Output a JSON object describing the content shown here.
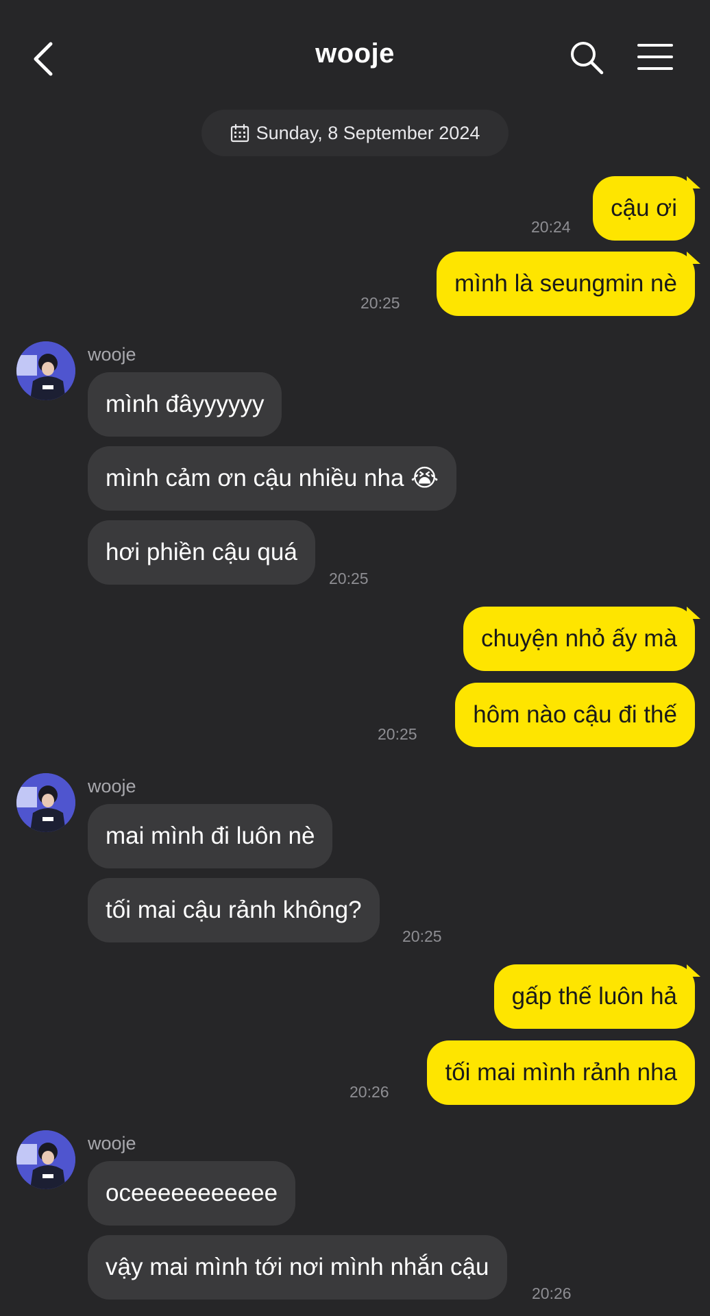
{
  "header": {
    "title": "wooje",
    "back_icon": "chevron-left-icon",
    "search_icon": "search-icon",
    "menu_icon": "hamburger-menu-icon"
  },
  "date_divider": {
    "icon": "calendar-icon",
    "text": "Sunday, 8 September 2024"
  },
  "colors": {
    "background": "#262628",
    "my_bubble": "#fee500",
    "their_bubble": "#3a3a3c",
    "timestamp": "#8e8e93"
  },
  "messages": [
    {
      "from": "me",
      "text": "cậu ơi",
      "time": "20:24"
    },
    {
      "from": "me",
      "text": "mình là seungmin nè",
      "time": "20:25"
    },
    {
      "from": "them",
      "sender": "wooje",
      "text": "mình đâyyyyyy"
    },
    {
      "from": "them",
      "text": "mình cảm ơn cậu nhiều nha 😭"
    },
    {
      "from": "them",
      "text": "hơi phiền cậu quá",
      "time": "20:25"
    },
    {
      "from": "me",
      "text": "chuyện nhỏ ấy mà"
    },
    {
      "from": "me",
      "text": "hôm nào cậu đi thế",
      "time": "20:25"
    },
    {
      "from": "them",
      "sender": "wooje",
      "text": "mai mình đi luôn nè"
    },
    {
      "from": "them",
      "text": "tối mai cậu rảnh không?",
      "time": "20:25"
    },
    {
      "from": "me",
      "text": "gấp thế luôn hả"
    },
    {
      "from": "me",
      "text": "tối mai mình rảnh nha",
      "time": "20:26"
    },
    {
      "from": "them",
      "sender": "wooje",
      "text": "oceeeeeeeeeee"
    },
    {
      "from": "them",
      "text": "vậy mai mình tới nơi mình nhắn cậu",
      "time": "20:26"
    }
  ]
}
